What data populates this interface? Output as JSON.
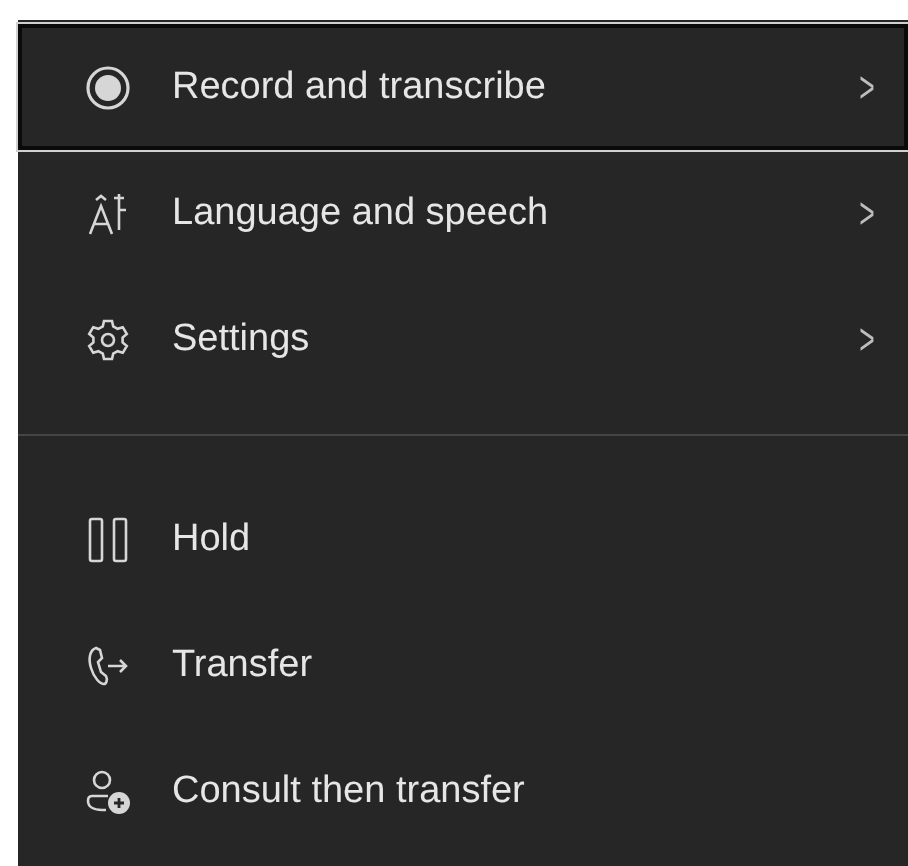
{
  "menu": {
    "sections": [
      {
        "items": [
          {
            "label": "Record and transcribe",
            "focused": true,
            "submenu_icon": ">"
          },
          {
            "label": "Language and speech",
            "focused": false,
            "submenu_icon": ">"
          },
          {
            "label": "Settings",
            "focused": false,
            "submenu_icon": ">"
          }
        ]
      },
      {
        "items": [
          {
            "label": "Hold",
            "focused": false
          },
          {
            "label": "Transfer",
            "focused": false
          },
          {
            "label": "Consult then transfer",
            "focused": false
          }
        ]
      }
    ]
  }
}
